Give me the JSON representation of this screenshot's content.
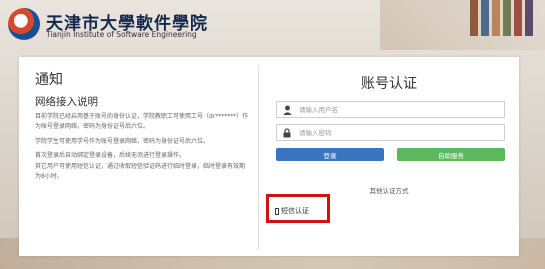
{
  "header": {
    "school_name_cn": "天津市大學軟件學院",
    "school_name_en": "Tianjin Institute of Software Engineering"
  },
  "notice": {
    "title": "通知",
    "subtitle": "网络接入说明",
    "paragraphs": [
      "目前学院已经启用基于账号的身份认证，学院教职工可使用工号（dr*******）作为账号登录网络，密码为身份证号后六位。",
      "学院学生可使用学号作为账号登录网络，密码为身份证号后六位。",
      "首次登录后自动绑定登录设备，后续无须进行登录操作。",
      "其它用户可使用短信认证，通过收取短信验证码进行临时登录，临时登录有效期为8小时。"
    ]
  },
  "login": {
    "title": "账号认证",
    "username_placeholder": "请输入用户名",
    "password_placeholder": "请输入密码",
    "login_button": "登录",
    "self_service_button": "自助服务",
    "other_methods_label": "其他认证方式",
    "sms_auth_label": "短信认证"
  },
  "colors": {
    "login_button": "#3a76c0",
    "self_service_button": "#5cb85c",
    "highlight_box": "#d20f16"
  },
  "icons": {
    "username": "user-icon",
    "password": "lock-icon",
    "sms": "phone-icon"
  }
}
